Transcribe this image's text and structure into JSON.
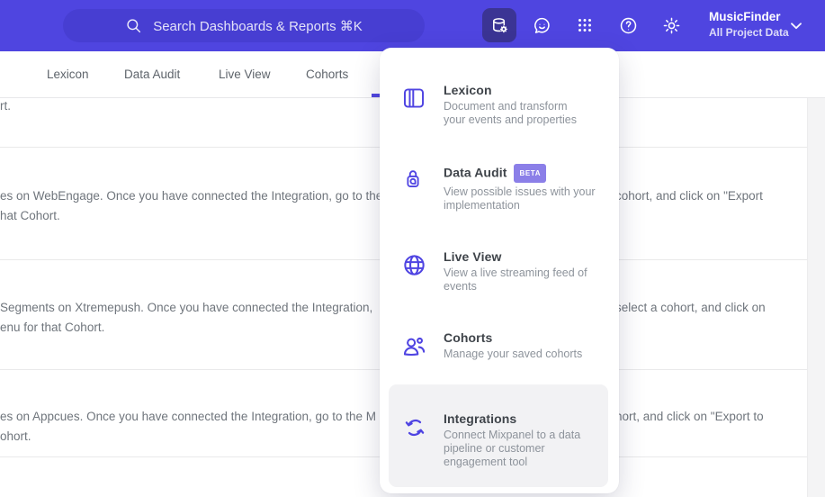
{
  "topbar": {
    "search": {
      "placeholder": "Search Dashboards & Reports ⌘K"
    },
    "icons": [
      "search-icon",
      "data-management-icon",
      "support-chat-icon",
      "apps-grid-icon",
      "help-icon",
      "settings-icon",
      "chevron-down-icon"
    ],
    "project": {
      "name": "MusicFinder",
      "scope": "All Project Data"
    }
  },
  "tabs": [
    {
      "label": "Lexicon"
    },
    {
      "label": "Data Audit"
    },
    {
      "label": "Live View"
    },
    {
      "label": "Cohorts"
    }
  ],
  "menu": {
    "items": [
      {
        "title": "Lexicon",
        "icon": "lexicon-book-icon",
        "desc_lines": [
          "Document and transform",
          "your events and properties"
        ]
      },
      {
        "title": "Data Audit",
        "icon": "data-audit-lock-icon",
        "badge": "BETA",
        "desc_lines": [
          "View possible issues with your",
          "implementation"
        ]
      },
      {
        "title": "Live View",
        "icon": "live-view-globe-icon",
        "desc_lines": [
          "View a live streaming feed of",
          "events"
        ]
      },
      {
        "title": "Cohorts",
        "icon": "cohorts-people-icon",
        "desc_lines": [
          "Manage your saved cohorts"
        ]
      },
      {
        "title": "Integrations",
        "icon": "integrations-sync-icon",
        "desc_lines": [
          "Connect Mixpanel to a data",
          "pipeline or customer",
          "engagement tool"
        ]
      }
    ]
  },
  "content": {
    "top_fragment": "rt.",
    "rows": [
      {
        "line1_left": "es on WebEngage. Once you have connected the Integration, go to the",
        "line1_right": "cohort, and click on \"Export",
        "line2": "hat Cohort."
      },
      {
        "line1_left": "Segments on Xtremepush. Once you have connected the Integration,",
        "line1_right": "select a cohort, and click on",
        "line2": "enu for that Cohort."
      },
      {
        "line1_left": "es on Appcues. Once you have connected the Integration, go to the M",
        "line1_right": "hort, and click on \"Export to",
        "line2": "ohort."
      }
    ]
  },
  "colors": {
    "topbar_bg": "#4F45E0",
    "search_bg": "#473ED2",
    "active_button_bg": "#3B3494",
    "accent": "#4F44E2",
    "badge_bg": "#8B7FE8",
    "highlight_bg": "#F2F2F4",
    "text_muted": "#6F757C"
  }
}
